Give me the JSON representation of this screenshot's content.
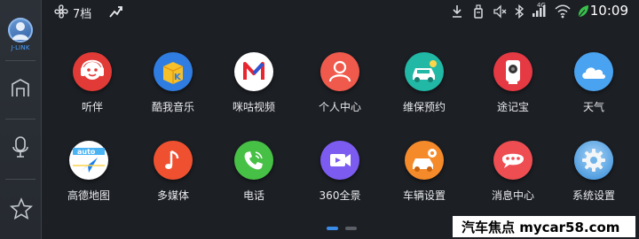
{
  "sidebar": {
    "profile_label": "J-LINK",
    "items": [
      {
        "icon": "home-icon"
      },
      {
        "icon": "microphone-icon"
      },
      {
        "icon": "star-icon"
      }
    ]
  },
  "status": {
    "fan_icon": "fan-icon",
    "fan_level": "7档",
    "time": "10:09",
    "network": "4G",
    "icons": [
      "shortcut-icon",
      "download-icon",
      "usb-icon",
      "mute-icon",
      "bluetooth-icon",
      "cellular-signal-icon",
      "wifi-icon",
      "leaf-icon"
    ]
  },
  "apps": [
    {
      "label": "听伴",
      "icon": "tingban-icon",
      "color": "#e23a36"
    },
    {
      "label": "酷我音乐",
      "icon": "kuwo-music-icon",
      "color": "#2f7de0"
    },
    {
      "label": "咪咕视频",
      "icon": "migu-video-icon",
      "color": "#ffffff"
    },
    {
      "label": "个人中心",
      "icon": "user-icon",
      "color": "#ef5a4c"
    },
    {
      "label": "维保预约",
      "icon": "car-service-icon",
      "color": "#21b8a6"
    },
    {
      "label": "途记宝",
      "icon": "dashcam-icon",
      "color": "#e53943"
    },
    {
      "label": "天气",
      "icon": "cloud-icon",
      "color": "#4aa3f0"
    },
    {
      "label": "高德地图",
      "icon": "amap-icon",
      "color": "#ffffff"
    },
    {
      "label": "多媒体",
      "icon": "music-note-icon",
      "color": "#ef5130"
    },
    {
      "label": "电话",
      "icon": "phone-icon",
      "color": "#47c046"
    },
    {
      "label": "360全景",
      "icon": "camera-icon",
      "color": "#7c5cf0"
    },
    {
      "label": "车辆设置",
      "icon": "car-settings-icon",
      "color": "#f58a2a"
    },
    {
      "label": "消息中心",
      "icon": "message-icon",
      "color": "#ee4e52"
    },
    {
      "label": "系统设置",
      "icon": "gear-icon",
      "color": "#6fb3e8"
    }
  ],
  "pager": {
    "pages": 2,
    "current": 1
  },
  "watermark": "汽车焦点  mycar58.com"
}
